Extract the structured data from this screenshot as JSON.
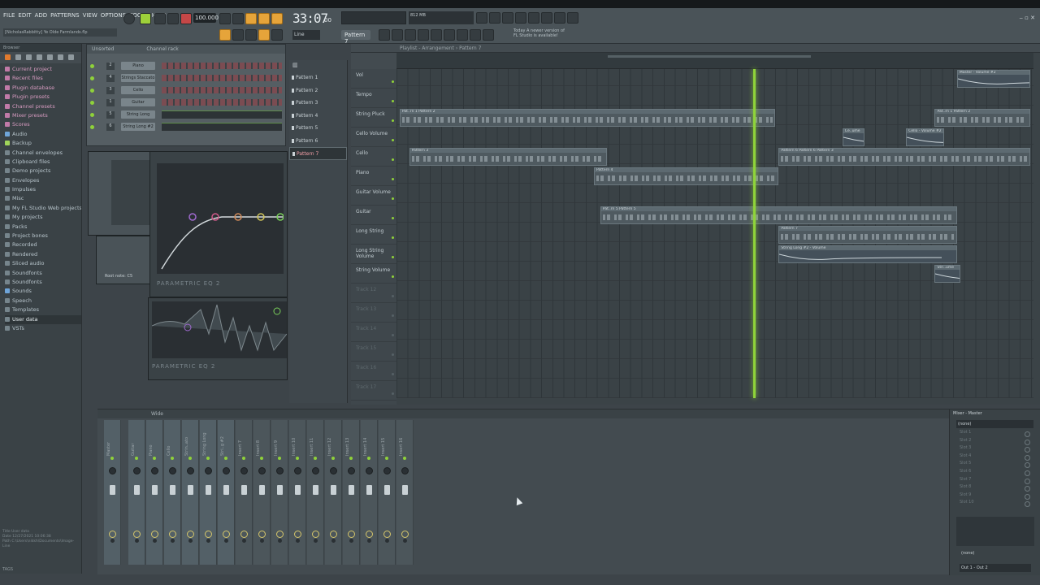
{
  "menu": [
    "FILE",
    "EDIT",
    "ADD",
    "PATTERNS",
    "VIEW",
    "OPTIONS",
    "TOOLS",
    "HELP"
  ],
  "project": {
    "title": "[NicholasRabbitty] Ye Olde Farmlands.flp"
  },
  "transport": {
    "tempo": "100.000",
    "time_main": "33:07",
    "time_sub": "00",
    "pattern": "Pattern 7",
    "snap": "Line",
    "cpu": "812 MB"
  },
  "news": {
    "line1": "Today  A newer version of",
    "line2": "FL Studio is available!"
  },
  "browser": {
    "title": "Browser",
    "items": [
      {
        "label": "Current project",
        "style": "pink"
      },
      {
        "label": "Recent files",
        "style": "pink"
      },
      {
        "label": "Plugin database",
        "style": "pink"
      },
      {
        "label": "Plugin presets",
        "style": "pink"
      },
      {
        "label": "Channel presets",
        "style": "pink"
      },
      {
        "label": "Mixer presets",
        "style": "pink"
      },
      {
        "label": "Scores",
        "style": "pink"
      },
      {
        "label": "Audio",
        "style": "blue"
      },
      {
        "label": "Backup",
        "style": "green"
      },
      {
        "label": "Channel envelopes",
        "style": ""
      },
      {
        "label": "Clipboard files",
        "style": ""
      },
      {
        "label": "Demo projects",
        "style": ""
      },
      {
        "label": "Envelopes",
        "style": ""
      },
      {
        "label": "Impulses",
        "style": ""
      },
      {
        "label": "Misc",
        "style": ""
      },
      {
        "label": "My FL Studio Web projects",
        "style": ""
      },
      {
        "label": "My projects",
        "style": ""
      },
      {
        "label": "Packs",
        "style": ""
      },
      {
        "label": "Project bones",
        "style": ""
      },
      {
        "label": "Recorded",
        "style": ""
      },
      {
        "label": "Rendered",
        "style": ""
      },
      {
        "label": "Sliced audio",
        "style": ""
      },
      {
        "label": "Soundfonts",
        "style": ""
      },
      {
        "label": "Soundfonts",
        "style": ""
      },
      {
        "label": "Sounds",
        "style": "blue"
      },
      {
        "label": "Speech",
        "style": ""
      },
      {
        "label": "Templates",
        "style": ""
      },
      {
        "label": "User data",
        "style": "sel"
      },
      {
        "label": "VSTs",
        "style": ""
      }
    ],
    "info_title": "Title   User data",
    "info_date": "Date    12/27/2021 10:06:38",
    "info_path": "Path    C:\\Users\\nikkh\\Documents\\Image-Line",
    "tags": "TAGS"
  },
  "channel_rack": {
    "group": "Unsorted",
    "title": "Channel rack",
    "channels": [
      {
        "num": "2",
        "name": "Piano",
        "type": "steps"
      },
      {
        "num": "4",
        "name": "Strings Staccato",
        "type": "steps"
      },
      {
        "num": "3",
        "name": "Cello",
        "type": "steps"
      },
      {
        "num": "1",
        "name": "Guitar",
        "type": "steps"
      },
      {
        "num": "5",
        "name": "String Long",
        "type": "roll"
      },
      {
        "num": "6",
        "name": "String Long #2",
        "type": "roll"
      }
    ]
  },
  "plugins": {
    "eq1": "PARAMETRIC EQ 2",
    "eq2": "PARAMETRIC EQ 2",
    "root_note": "Root note: C5"
  },
  "patterns": [
    "Pattern 1",
    "Pattern 2",
    "Pattern 3",
    "Pattern 4",
    "Pattern 5",
    "Pattern 6",
    "Pattern 7"
  ],
  "playlist": {
    "title": "Playlist - Arrangement › Pattern 7",
    "tracks": [
      "Vol",
      "Tempo",
      "String Pluck",
      "Cello Volume",
      "Cello",
      "Piano",
      "Guitar Volume",
      "Guitar",
      "Long String",
      "Long String Volume",
      "String Volume",
      "Track 12",
      "Track 13",
      "Track 14",
      "Track 15",
      "Track 16",
      "Track 17"
    ],
    "clips": [
      {
        "label": "Master - Volume #2",
        "track": 0,
        "start": 0.88,
        "len": 0.115,
        "kind": "auto"
      },
      {
        "label": "Pat..rn 1  Pattern 2",
        "track": 2,
        "start": 0.005,
        "len": 0.59,
        "kind": "notes"
      },
      {
        "label": "Pat..rn 1  Pattern 2",
        "track": 2,
        "start": 0.845,
        "len": 0.15,
        "kind": "notes"
      },
      {
        "label": "Ce..ume",
        "track": 3,
        "start": 0.7,
        "len": 0.035,
        "kind": "auto"
      },
      {
        "label": "Cello - Volume #2",
        "track": 3,
        "start": 0.8,
        "len": 0.06,
        "kind": "auto"
      },
      {
        "label": "Pattern 3",
        "track": 4,
        "start": 0.02,
        "len": 0.31,
        "kind": "notes"
      },
      {
        "label": "Pattern 6  Pattern 6  Pattern 3",
        "track": 4,
        "start": 0.6,
        "len": 0.395,
        "kind": "notes"
      },
      {
        "label": "Pattern 4",
        "track": 5,
        "start": 0.31,
        "len": 0.29,
        "kind": "notes"
      },
      {
        "label": "Pat..rn 5  Pattern 5",
        "track": 7,
        "start": 0.32,
        "len": 0.56,
        "kind": "notes"
      },
      {
        "label": "Pattern 7",
        "track": 8,
        "start": 0.6,
        "len": 0.28,
        "kind": "notes"
      },
      {
        "label": "String Long #2 - Volume",
        "track": 9,
        "start": 0.6,
        "len": 0.28,
        "kind": "auto"
      },
      {
        "label": "Stri..ume",
        "track": 10,
        "start": 0.845,
        "len": 0.04,
        "kind": "auto"
      }
    ],
    "playhead": 0.56
  },
  "mixer": {
    "mode": "Wide",
    "strips": [
      "Master",
      "Guitar",
      "Piano",
      "Cello",
      "Strin..ato",
      "String Long",
      "Stri..g #2",
      "Insert 7",
      "Insert 8",
      "Insert 9",
      "Insert 10",
      "Insert 11",
      "Insert 12",
      "Insert 13",
      "Insert 14",
      "Insert 15",
      "Insert 16"
    ],
    "right_title": "Mixer - Master",
    "preset": "(none)",
    "slots": [
      "Slot 1",
      "Slot 2",
      "Slot 3",
      "Slot 4",
      "Slot 5",
      "Slot 6",
      "Slot 7",
      "Slot 8",
      "Slot 9",
      "Slot 10"
    ],
    "eq_preset": "(none)",
    "output": "Out 1 - Out 2"
  }
}
